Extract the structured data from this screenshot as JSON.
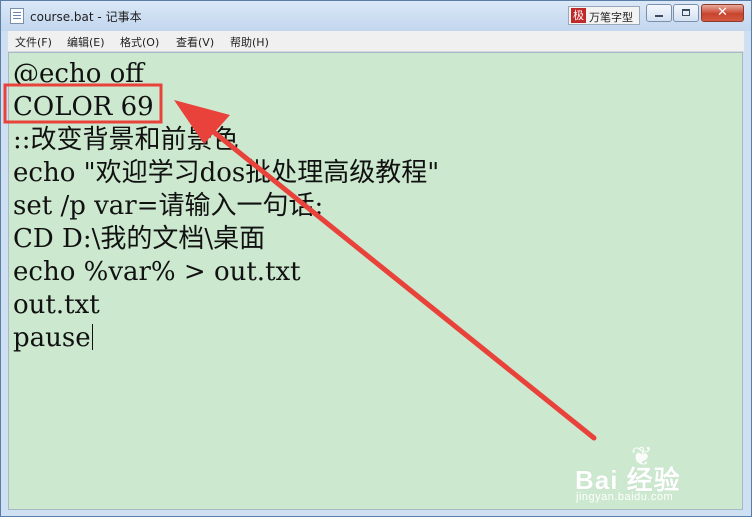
{
  "window": {
    "title": "course.bat - 记事本"
  },
  "ime": {
    "logo": "极",
    "label": "万笔字型"
  },
  "controls": {
    "close_glyph": "✕"
  },
  "menu": {
    "items": [
      {
        "label": "文件(F)"
      },
      {
        "label": "编辑(E)"
      },
      {
        "label": "格式(O)"
      },
      {
        "label": "查看(V)"
      },
      {
        "label": "帮助(H)"
      }
    ]
  },
  "editor": {
    "lines": [
      "@echo off",
      "COLOR 69",
      "::改变背景和前景色",
      "echo \"欢迎学习dos批处理高级教程\"",
      "set /p var=请输入一句话:",
      "CD D:\\我的文档\\桌面",
      "echo %var% > out.txt",
      "out.txt",
      "pause"
    ],
    "background": "#cce8cf"
  },
  "annotation": {
    "color": "#e8423a",
    "highlighted_line": "COLOR 69"
  },
  "watermark": {
    "brand": "Bai  经验",
    "sub": "jingyan.baidu.com"
  }
}
